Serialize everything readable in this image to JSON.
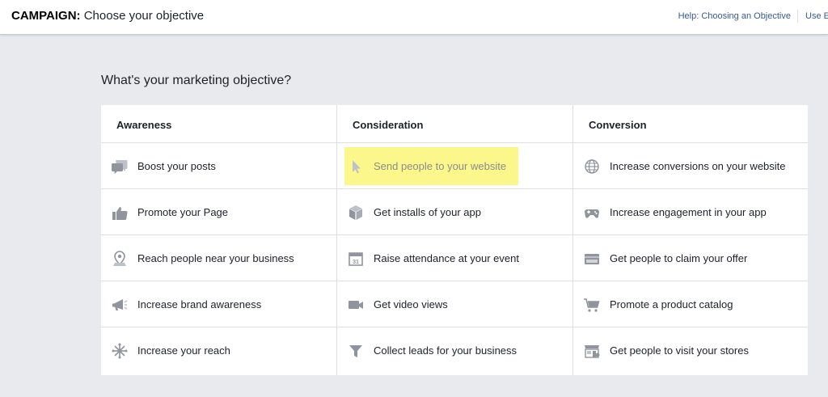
{
  "header": {
    "title_bold": "CAMPAIGN:",
    "title_rest": " Choose your objective",
    "help_link": "Help: Choosing an Objective",
    "use_link": "Use E"
  },
  "question": "What's your marketing objective?",
  "columns": [
    {
      "heading": "Awareness",
      "items": [
        {
          "label": "Boost your posts",
          "icon": "speech-bubbles-icon"
        },
        {
          "label": "Promote your Page",
          "icon": "thumbs-up-icon"
        },
        {
          "label": "Reach people near your business",
          "icon": "map-pin-icon"
        },
        {
          "label": "Increase brand awareness",
          "icon": "megaphone-icon"
        },
        {
          "label": "Increase your reach",
          "icon": "asterisk-reach-icon"
        }
      ]
    },
    {
      "heading": "Consideration",
      "items": [
        {
          "label": "Send people to your website",
          "icon": "cursor-icon",
          "selected": true
        },
        {
          "label": "Get installs of your app",
          "icon": "app-box-icon"
        },
        {
          "label": "Raise attendance at your event",
          "icon": "calendar-icon"
        },
        {
          "label": "Get video views",
          "icon": "video-camera-icon"
        },
        {
          "label": "Collect leads for your business",
          "icon": "funnel-icon"
        }
      ]
    },
    {
      "heading": "Conversion",
      "items": [
        {
          "label": "Increase conversions on your website",
          "icon": "globe-icon"
        },
        {
          "label": "Increase engagement in your app",
          "icon": "gamepad-icon"
        },
        {
          "label": "Get people to claim your offer",
          "icon": "offer-card-icon"
        },
        {
          "label": "Promote a product catalog",
          "icon": "shopping-cart-icon"
        },
        {
          "label": "Get people to visit your stores",
          "icon": "storefront-icon"
        }
      ]
    }
  ],
  "colors": {
    "highlight": "#fbf78a",
    "link": "#365899",
    "icon": "#90949c",
    "background": "#e9eaed"
  }
}
